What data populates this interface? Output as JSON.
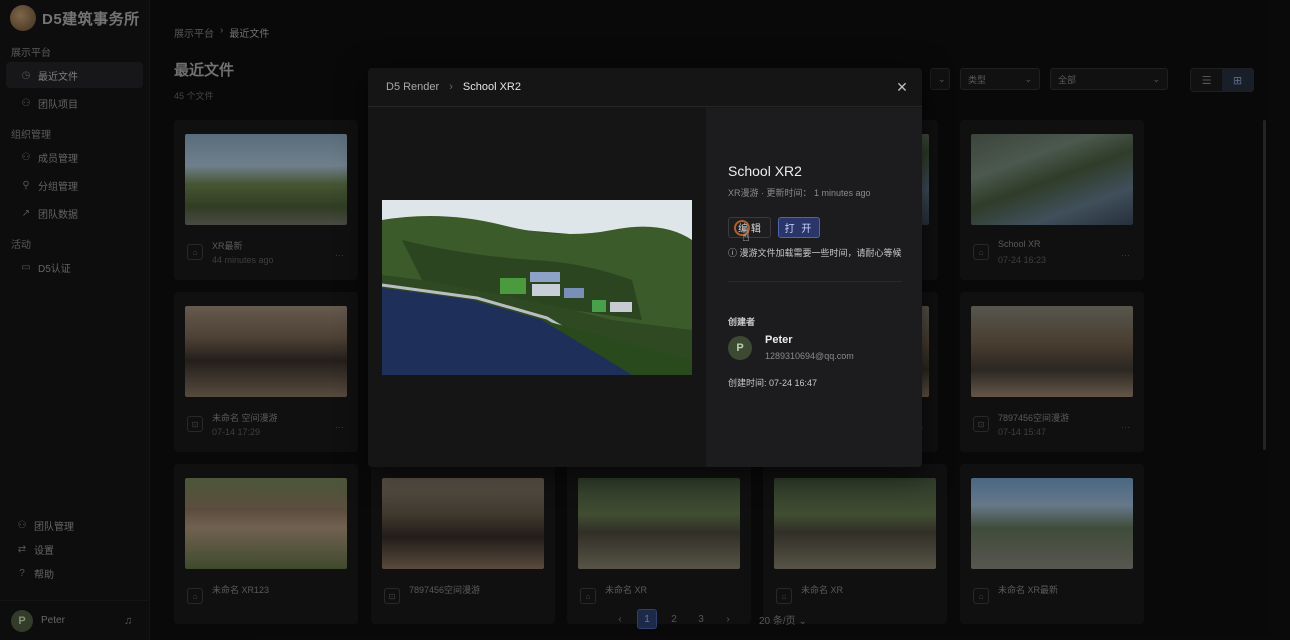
{
  "brand": {
    "name": "D5建筑事务所"
  },
  "sidebar": {
    "sections": [
      {
        "title": "展示平台",
        "items": [
          {
            "label": "最近文件",
            "icon": "clock-icon",
            "active": true
          },
          {
            "label": "团队项目",
            "icon": "team-icon"
          }
        ]
      },
      {
        "title": "组织管理",
        "items": [
          {
            "label": "成员管理",
            "icon": "members-icon"
          },
          {
            "label": "分组管理",
            "icon": "group-icon"
          },
          {
            "label": "团队数据",
            "icon": "chart-icon"
          }
        ]
      },
      {
        "title": "活动",
        "items": [
          {
            "label": "D5认证",
            "icon": "ticket-icon"
          }
        ]
      }
    ],
    "bottom": [
      {
        "label": "团队管理",
        "icon": "team-icon"
      },
      {
        "label": "设置",
        "icon": "settings-icon"
      },
      {
        "label": "帮助",
        "icon": "help-icon"
      }
    ],
    "user": {
      "initial": "P",
      "name": "Peter"
    }
  },
  "main": {
    "breadcrumb": {
      "root": "展示平台",
      "current": "最近文件"
    },
    "title": "最近文件",
    "count": "45 个文件",
    "filters": {
      "type_label": "类型",
      "scope_label": "全部"
    },
    "files": [
      {
        "title": "XR最新",
        "sub": "44 minutes ago"
      },
      {
        "title": "",
        "sub": ""
      },
      {
        "title": "",
        "sub": ""
      },
      {
        "title": "School XR",
        "sub": "07-24 16:23"
      },
      {
        "title": "未命名 空间漫游",
        "sub": "07-14 17:29"
      },
      {
        "title": "7897456空间漫游",
        "sub": "07-14 15:47"
      },
      {
        "title": "未命名 XR123",
        "sub": ""
      },
      {
        "title": "7897456空间漫游",
        "sub": ""
      },
      {
        "title": "未命名 XR",
        "sub": ""
      },
      {
        "title": "未命名 XR",
        "sub": ""
      },
      {
        "title": "未命名 XR最新",
        "sub": ""
      }
    ],
    "pager": {
      "pages": [
        "1",
        "2",
        "3"
      ],
      "current": "1",
      "page_size": "20 条/页"
    }
  },
  "modal": {
    "breadcrumb": {
      "root": "D5 Render",
      "current": "School XR2"
    },
    "title": "School XR2",
    "meta": "XR漫游 · 更新时间： 1 minutes ago",
    "edit_label": "编 辑",
    "open_label": "打 开",
    "notice": "ⓘ 漫游文件加载需要一些时间，请耐心等候",
    "creator_label": "创建者",
    "creator": {
      "initial": "P",
      "name": "Peter",
      "email": "1289310694@qq.com"
    },
    "created_time": "创建时间: 07-24 16:47"
  },
  "colors": {
    "accent": "#4f63b0",
    "avatar": "#3d4a33",
    "background": "#0c0c0d"
  }
}
